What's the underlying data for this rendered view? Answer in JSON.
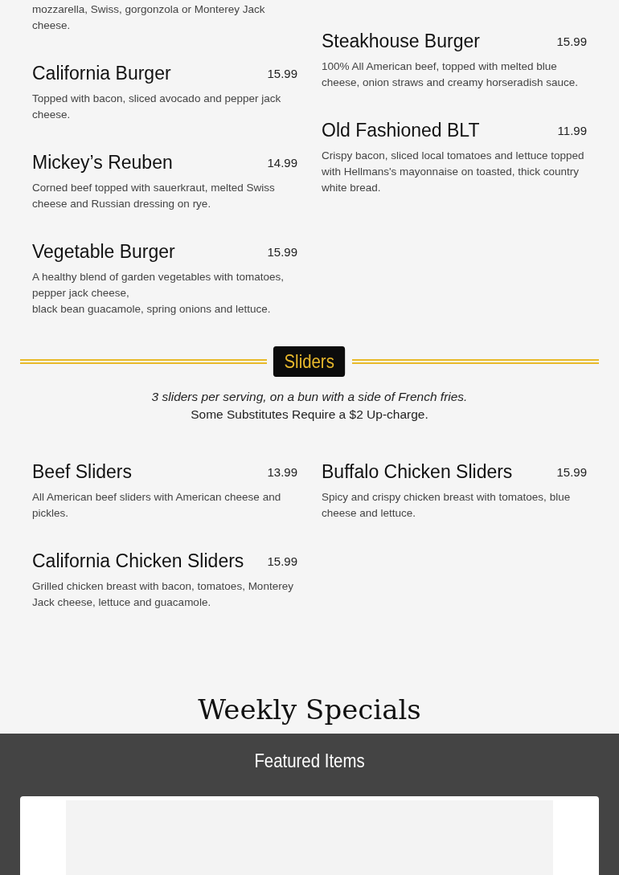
{
  "burgers": {
    "left_fragment": "mozzarella, Swiss, gorgonzola or Monterey Jack cheese.",
    "left_items": [
      {
        "name": "California Burger",
        "price": "15.99",
        "description": "Topped with bacon, sliced avocado and pepper jack cheese."
      },
      {
        "name": "Mickey’s Reuben",
        "price": "14.99",
        "description": "Corned beef topped with sauerkraut, melted Swiss cheese and Russian dressing on rye."
      },
      {
        "name": "Vegetable Burger",
        "price": "15.99",
        "description": "A healthy blend of garden vegetables with tomatoes, pepper jack cheese,\nblack bean guacamole, spring onions and lettuce."
      }
    ],
    "right_items": [
      {
        "name": "Steakhouse Burger",
        "price": "15.99",
        "description": "100% All American beef, topped with melted blue cheese, onion straws and creamy horseradish sauce."
      },
      {
        "name": "Old Fashioned BLT",
        "price": "11.99",
        "description": "Crispy bacon, sliced local tomatoes and lettuce topped with Hellmans's mayonnaise on toasted, thick country white bread."
      }
    ]
  },
  "sliders": {
    "title": "Sliders",
    "note": "3 sliders per serving, on a bun with a side of French fries.",
    "surcharge": "Some Substitutes Require a $2 Up-charge.",
    "left_items": [
      {
        "name": "Beef Sliders",
        "price": "13.99",
        "description": "All American beef sliders with American cheese and pickles."
      },
      {
        "name": "California Chicken Sliders",
        "price": "15.99",
        "description": "Grilled chicken breast with bacon, tomatoes, Monterey Jack cheese, lettuce and guacamole."
      }
    ],
    "right_items": [
      {
        "name": "Buffalo Chicken Sliders",
        "price": "15.99",
        "description": "Spicy and crispy chicken breast with tomatoes, blue cheese and lettuce."
      }
    ]
  },
  "weekly_specials": {
    "title": "Weekly Specials"
  },
  "featured": {
    "title": "Featured Items"
  }
}
